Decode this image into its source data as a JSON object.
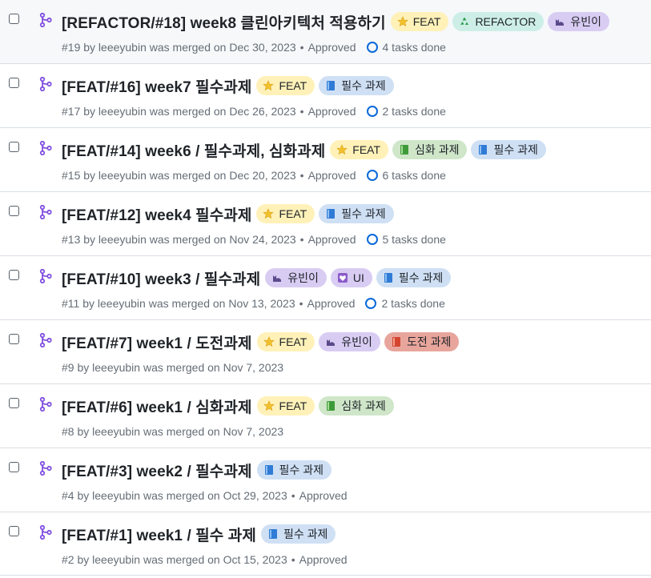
{
  "colors": {
    "feat": "#fff1b8",
    "refactor": "#cdeee6",
    "yubin": "#d9ccf3",
    "required": "#cfe0f5",
    "advanced": "#cfe6c9",
    "challenge": "#e8a59c",
    "ui": "#d9ccf3"
  },
  "pulls": [
    {
      "title": "[REFACTOR/#18] week8 클린아키텍처 적용하기",
      "labels": [
        {
          "text": "FEAT",
          "kind": "feat",
          "icon": "star-icon"
        },
        {
          "text": "REFACTOR",
          "kind": "refactor",
          "icon": "recycle-icon"
        },
        {
          "text": "유빈이",
          "kind": "yubin",
          "icon": "cat-icon"
        }
      ],
      "number": "#19",
      "by": "by leeeyubin was merged on Dec 30, 2023",
      "approved": "Approved",
      "tasks": "4 tasks done"
    },
    {
      "title": "[FEAT/#16] week7 필수과제",
      "labels": [
        {
          "text": "FEAT",
          "kind": "feat",
          "icon": "star-icon"
        },
        {
          "text": "필수 과제",
          "kind": "required",
          "icon": "blue-book-icon"
        }
      ],
      "number": "#17",
      "by": "by leeeyubin was merged on Dec 26, 2023",
      "approved": "Approved",
      "tasks": "2 tasks done"
    },
    {
      "title": "[FEAT/#14] week6 / 필수과제, 심화과제",
      "labels": [
        {
          "text": "FEAT",
          "kind": "feat",
          "icon": "star-icon"
        },
        {
          "text": "심화 과제",
          "kind": "advanced",
          "icon": "green-book-icon"
        },
        {
          "text": "필수 과제",
          "kind": "required",
          "icon": "blue-book-icon"
        }
      ],
      "number": "#15",
      "by": "by leeeyubin was merged on Dec 20, 2023",
      "approved": "Approved",
      "tasks": "6 tasks done"
    },
    {
      "title": "[FEAT/#12] week4 필수과제",
      "labels": [
        {
          "text": "FEAT",
          "kind": "feat",
          "icon": "star-icon"
        },
        {
          "text": "필수 과제",
          "kind": "required",
          "icon": "blue-book-icon"
        }
      ],
      "number": "#13",
      "by": "by leeeyubin was merged on Nov 24, 2023",
      "approved": "Approved",
      "tasks": "5 tasks done"
    },
    {
      "title": "[FEAT/#10] week3 / 필수과제",
      "labels": [
        {
          "text": "유빈이",
          "kind": "yubin",
          "icon": "cat-icon"
        },
        {
          "text": "UI",
          "kind": "ui",
          "icon": "heart-icon"
        },
        {
          "text": "필수 과제",
          "kind": "required",
          "icon": "blue-book-icon"
        }
      ],
      "number": "#11",
      "by": "by leeeyubin was merged on Nov 13, 2023",
      "approved": "Approved",
      "tasks": "2 tasks done"
    },
    {
      "title": "[FEAT/#7] week1 / 도전과제",
      "labels": [
        {
          "text": "FEAT",
          "kind": "feat",
          "icon": "star-icon"
        },
        {
          "text": "유빈이",
          "kind": "yubin",
          "icon": "cat-icon"
        },
        {
          "text": "도전 과제",
          "kind": "challenge",
          "icon": "red-book-icon"
        }
      ],
      "number": "#9",
      "by": "by leeeyubin was merged on Nov 7, 2023",
      "approved": "",
      "tasks": ""
    },
    {
      "title": "[FEAT/#6] week1 / 심화과제",
      "labels": [
        {
          "text": "FEAT",
          "kind": "feat",
          "icon": "star-icon"
        },
        {
          "text": "심화 과제",
          "kind": "advanced",
          "icon": "green-book-icon"
        }
      ],
      "number": "#8",
      "by": "by leeeyubin was merged on Nov 7, 2023",
      "approved": "",
      "tasks": ""
    },
    {
      "title": "[FEAT/#3] week2 / 필수과제",
      "labels": [
        {
          "text": "필수 과제",
          "kind": "required",
          "icon": "blue-book-icon"
        }
      ],
      "number": "#4",
      "by": "by leeeyubin was merged on Oct 29, 2023",
      "approved": "Approved",
      "tasks": ""
    },
    {
      "title": "[FEAT/#1] week1 / 필수 과제",
      "labels": [
        {
          "text": "필수 과제",
          "kind": "required",
          "icon": "blue-book-icon"
        }
      ],
      "number": "#2",
      "by": "by leeeyubin was merged on Oct 15, 2023",
      "approved": "Approved",
      "tasks": ""
    }
  ]
}
